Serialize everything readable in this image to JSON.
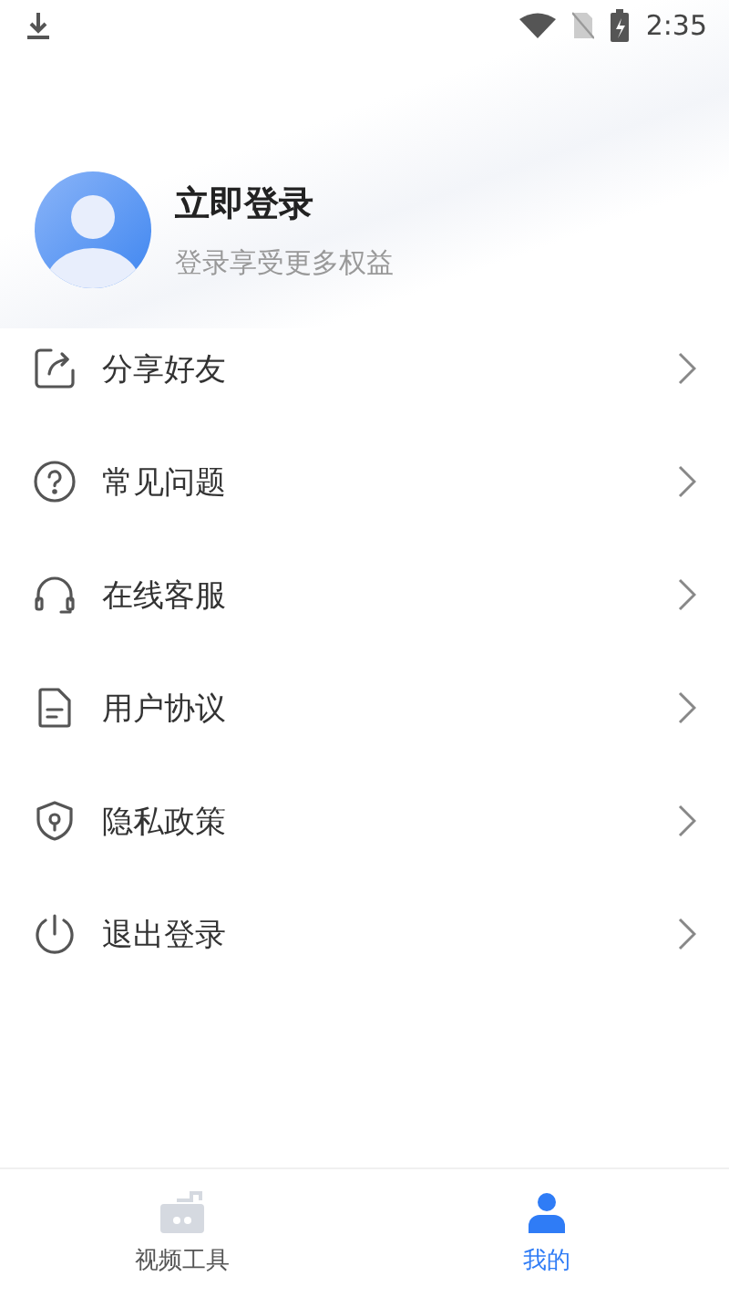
{
  "status_bar": {
    "time": "2:35"
  },
  "profile": {
    "title": "立即登录",
    "subtitle": "登录享受更多权益"
  },
  "menu": [
    {
      "kind": "share",
      "label": "分享好友"
    },
    {
      "kind": "help",
      "label": "常见问题"
    },
    {
      "kind": "headset",
      "label": "在线客服"
    },
    {
      "kind": "document",
      "label": "用户协议"
    },
    {
      "kind": "shield",
      "label": "隐私政策"
    },
    {
      "kind": "power",
      "label": "退出登录"
    }
  ],
  "bottom_nav": [
    {
      "kind": "video",
      "label": "视频工具",
      "selected": false
    },
    {
      "kind": "person",
      "label": "我的",
      "selected": true
    }
  ]
}
